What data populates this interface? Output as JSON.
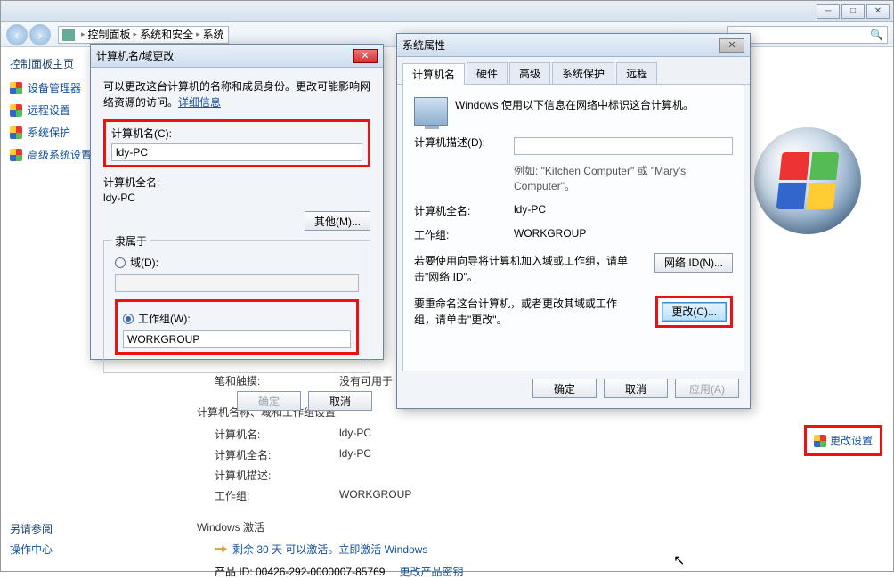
{
  "breadcrumb": {
    "item1": "控制面板",
    "item2": "系统和安全",
    "item3": "系统"
  },
  "sidebar": {
    "title": "控制面板主页",
    "items": [
      "设备管理器",
      "远程设置",
      "系统保护",
      "高级系统设置"
    ],
    "see_also": "另请参阅",
    "action_center": "操作中心"
  },
  "main": {
    "pen_touch_label": "笔和触摸:",
    "pen_touch_value": "没有可用于",
    "section_title": "计算机名称、域和工作组设置",
    "computer_name_label": "计算机名:",
    "computer_name_value": "ldy-PC",
    "full_name_label": "计算机全名:",
    "full_name_value": "ldy-PC",
    "desc_label": "计算机描述:",
    "workgroup_label": "工作组:",
    "workgroup_value": "WORKGROUP",
    "change_settings": "更改设置",
    "activation_title": "Windows 激活",
    "activation_text": "剩余 30 天 可以激活。立即激活 Windows",
    "product_id_label": "产品 ID: 00426-292-0000007-85769",
    "change_key": "更改产品密钥"
  },
  "dlg1": {
    "title": "计算机名/域更改",
    "desc_a": "可以更改这台计算机的名称和成员身份。更改可能影响网络资源的访问。",
    "desc_link": "详细信息",
    "cname_label": "计算机名(C):",
    "cname_value": "ldy-PC",
    "fullname_label": "计算机全名:",
    "fullname_value": "ldy-PC",
    "other_btn": "其他(M)...",
    "member_of": "隶属于",
    "domain_label": "域(D):",
    "workgroup_label": "工作组(W):",
    "workgroup_value": "WORKGROUP",
    "ok": "确定",
    "cancel": "取消"
  },
  "dlg2": {
    "title": "系统属性",
    "tabs": [
      "计算机名",
      "硬件",
      "高级",
      "系统保护",
      "远程"
    ],
    "intro": "Windows 使用以下信息在网络中标识这台计算机。",
    "desc_label": "计算机描述(D):",
    "desc_example": "例如: \"Kitchen Computer\" 或 \"Mary's Computer\"。",
    "fullname_label": "计算机全名:",
    "fullname_value": "ldy-PC",
    "workgroup_label": "工作组:",
    "workgroup_value": "WORKGROUP",
    "wizard_text": "若要使用向导将计算机加入域或工作组，请单击\"网络 ID\"。",
    "network_id_btn": "网络 ID(N)...",
    "rename_text": "要重命名这台计算机，或者更改其域或工作组，请单击\"更改\"。",
    "change_btn": "更改(C)...",
    "ok": "确定",
    "cancel": "取消",
    "apply": "应用(A)"
  }
}
